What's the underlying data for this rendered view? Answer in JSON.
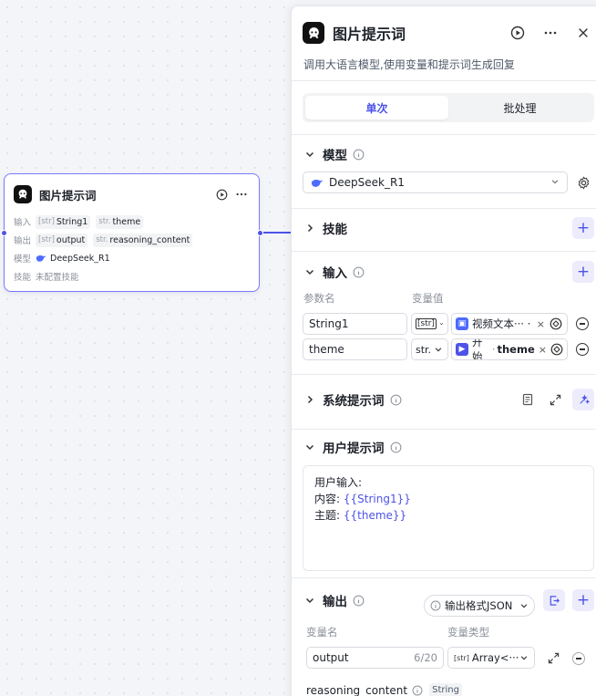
{
  "node": {
    "title": "图片提示词",
    "rows": [
      {
        "label": "输入",
        "items": [
          {
            "type": "[str]",
            "name": "String1"
          },
          {
            "type": "str.",
            "name": "theme"
          }
        ]
      },
      {
        "label": "输出",
        "items": [
          {
            "type": "[str]",
            "name": "output"
          },
          {
            "type": "str.",
            "name": "reasoning_content"
          }
        ]
      },
      {
        "label": "模型",
        "model": "DeepSeek_R1"
      },
      {
        "label": "技能",
        "value": "未配置技能"
      }
    ]
  },
  "panel": {
    "title": "图片提示词",
    "description": "调用大语言模型,使用变量和提示词生成回复",
    "tabs": [
      {
        "label": "单次",
        "active": true
      },
      {
        "label": "批处理",
        "active": false
      }
    ],
    "model": {
      "section": "模型",
      "value": "DeepSeek_R1"
    },
    "skills": {
      "section": "技能"
    },
    "input": {
      "section": "输入",
      "col_name": "参数名",
      "col_value": "变量值",
      "rows": [
        {
          "name": "String1",
          "type": "[str]",
          "ref": "视频文本···  ·"
        },
        {
          "name": "theme",
          "type": "str.",
          "ref_source": "开始",
          "ref_var": "theme"
        }
      ]
    },
    "system_prompt": {
      "section": "系统提示词"
    },
    "user_prompt": {
      "section": "用户提示词",
      "lines": [
        {
          "text": "用户输入:"
        },
        {
          "text": "内容: ",
          "var": "{{String1}}"
        },
        {
          "text": "主题: ",
          "var": "{{theme}}"
        }
      ]
    },
    "output": {
      "section": "输出",
      "format": "输出格式JSON",
      "col_name": "变量名",
      "col_type": "变量类型",
      "var_name": "output",
      "counter": "6/20",
      "var_type": "Array<···",
      "reasoning_name": "reasoning_content",
      "reasoning_type": "String"
    }
  },
  "colors": {
    "accent": "#4d53e8",
    "selected_border": "#7b78ff"
  }
}
